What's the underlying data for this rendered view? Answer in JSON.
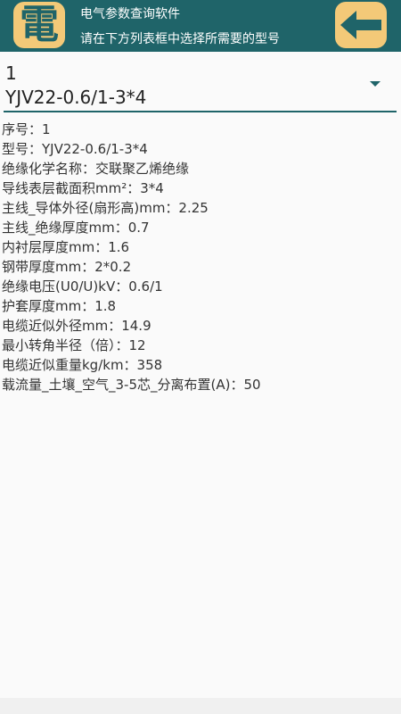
{
  "header": {
    "app_icon_glyph": "電",
    "title": "电气参数查询软件",
    "subtitle": "请在下方列表框中选择所需要的型号",
    "back_icon": "left-arrow-icon"
  },
  "selector": {
    "id": "1",
    "model": "YJV22-0.6/1-3*4"
  },
  "details": [
    "序号：1",
    "型号：YJV22-0.6/1-3*4",
    "绝缘化学名称：交联聚乙烯绝缘",
    "导线表层截面积mm²：3*4",
    "主线_导体外径(扇形高)mm：2.25",
    "主线_绝缘厚度mm：0.7",
    "内衬层厚度mm：1.6",
    "钢带厚度mm：2*0.2",
    "绝缘电压(U0/U)kV：0.6/1",
    "护套厚度mm：1.8",
    "电缆近似外径mm：14.9",
    "最小转角半径（倍）：12",
    "电缆近似重量kg/km：358",
    "载流量_土壤_空气_3-5芯_分离布置(A)：50"
  ],
  "colors": {
    "header_bg": "#1f6469",
    "icon_bg": "#f3c978",
    "accent": "#1f6469"
  }
}
